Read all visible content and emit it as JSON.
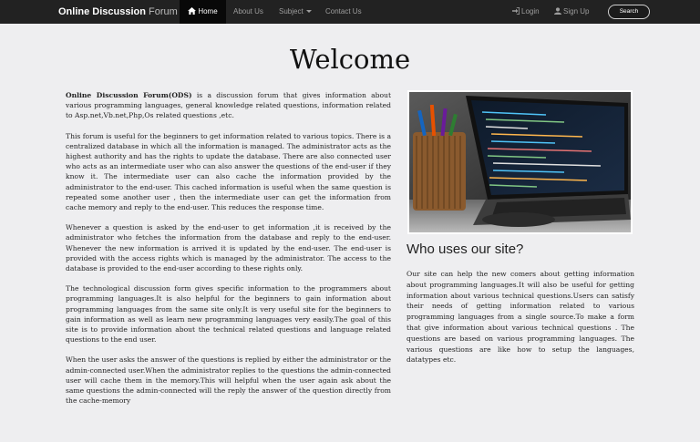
{
  "navbar": {
    "brand_bold": "Online Discussion",
    "brand_light": "Forum",
    "home": "Home",
    "about": "About Us",
    "subject": "Subject",
    "contact": "Contact Us",
    "login": "Login",
    "signup": "Sign Up",
    "search": "Search"
  },
  "main": {
    "title": "Welcome",
    "intro_bold": "Online Discussion Forum(ODS)",
    "intro_rest": " is a discussion forum that gives information about various programming languages, general knowledge related questions, information related to Asp.net,Vb.net,Php,Os related questions ,etc.",
    "para2": "This forum is useful for the beginners to get information related to various topics. There is a centralized database in which all the information is managed. The administrator acts as the highest authority and has the rights to update the database. There are also connected user who acts as an intermediate user who can also answer the questions of the end-user if they know it. The intermediate user can also cache the information provided by the administrator to the end-user. This cached information is useful when the same question is repeated some another user , then the intermediate user can get the information from cache memory and reply to the end-user. This reduces the response time.",
    "para3": "Whenever a question is asked by the end-user to get information ,it is received by the administrator who fetches the information from the database and reply to the end-user. Whenever the new information is arrived it is updated by the end-user. The end-user is provided with the access rights which is managed by the administrator. The access to the database is provided to the end-user according to these rights only.",
    "para4": "The technological discussion form gives specific information to the programmers about programming languages.It is also helpful for the beginners to gain information about programming languages from the same site only.It is very useful site for the beginners to gain information as well as learn new programming languages very easily.The goal of this site is to provide information about the technical related questions and language related questions to the end user.",
    "para5": "When the user asks the answer of the questions is replied by either the administrator or the admin-connected user.When the administrator replies to the questions the admin-connected user will cache them in the memory.This will helpful when the user again ask about the same questions the admin-connected will the reply the answer of the question directly from the cache-memory"
  },
  "sidebar": {
    "title": "Who uses our site?",
    "text": "Our site can help the new comers about getting information about programming languages.It will also be useful for getting information about various technical questions.Users can satisfy their needs of getting information related to various programming languages from a single source.To make a form that give information about various technical questions . The questions are based on various programming languages. The various questions are like how to setup the languages, datatypes etc."
  }
}
